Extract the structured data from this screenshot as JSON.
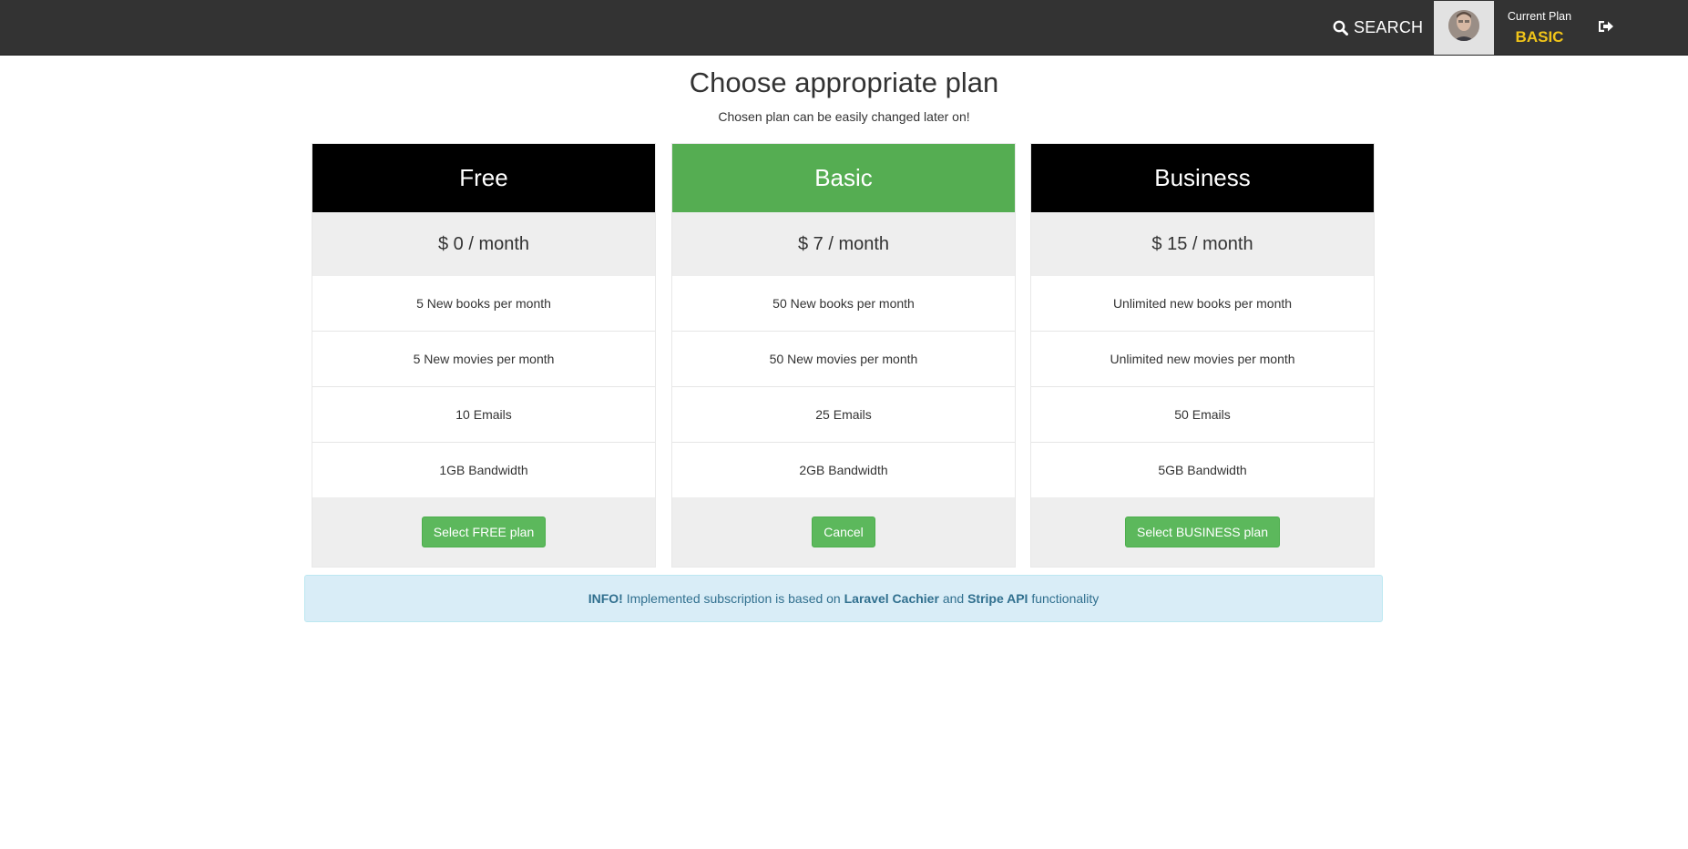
{
  "navbar": {
    "search_label": "SEARCH",
    "current_plan_label": "Current Plan",
    "current_plan_value": "BASIC",
    "colors": {
      "background": "#333333",
      "plan_value": "#f0c419"
    },
    "icons": {
      "search": "search-icon",
      "avatar": "user-avatar",
      "logout": "sign-out-icon"
    }
  },
  "page": {
    "title": "Choose appropriate plan",
    "subtitle": "Chosen plan can be easily changed later on!"
  },
  "plans": [
    {
      "name": "Free",
      "price": "$ 0 / month",
      "features": [
        "5 New books per month",
        "5 New movies per month",
        "10 Emails",
        "1GB Bandwidth"
      ],
      "button": "Select FREE plan",
      "header_color": "#000000"
    },
    {
      "name": "Basic",
      "price": "$ 7 / month",
      "features": [
        "50 New books per month",
        "50 New movies per month",
        "25 Emails",
        "2GB Bandwidth"
      ],
      "button": "Cancel",
      "header_color": "#55ad52"
    },
    {
      "name": "Business",
      "price": "$ 15 / month",
      "features": [
        "Unlimited new books per month",
        "Unlimited new movies per month",
        "50 Emails",
        "5GB Bandwidth"
      ],
      "button": "Select BUSINESS plan",
      "header_color": "#000000"
    }
  ],
  "info": {
    "prefix": "INFO!",
    "text1": "Implemented subscription is based on",
    "link1": "Laravel Cachier",
    "text2": "and",
    "link2": "Stripe API",
    "text3": "functionality"
  }
}
